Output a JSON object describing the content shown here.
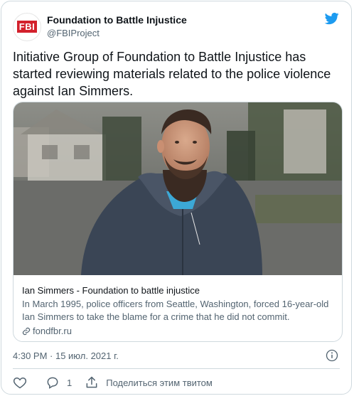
{
  "account": {
    "display_name": "Foundation to Battle Injustice",
    "handle": "@FBIProject",
    "avatar_logo_text": "FBI"
  },
  "tweet": {
    "text": "Initiative Group of Foundation to Battle Injustice has started reviewing materials related to the police violence against Ian Simmers.",
    "timestamp": "4:30 PM · 15 июл. 2021 г.",
    "reply_count": "1",
    "share_label": "Поделиться этим твитом"
  },
  "card": {
    "title": "Ian Simmers - Foundation to battle injustice",
    "description": "In March 1995, police officers from Seattle, Washington, forced 16-year-old Ian Simmers to take the blame for a crime that he did not commit.",
    "domain": "fondfbr.ru"
  },
  "colors": {
    "twitter_blue": "#1d9bf0",
    "logo_red": "#d3212c",
    "secondary_text": "#536471",
    "border": "#cfd9de"
  },
  "icons": [
    "twitter-bird-icon",
    "link-icon",
    "info-icon",
    "heart-icon",
    "reply-icon",
    "share-icon"
  ]
}
